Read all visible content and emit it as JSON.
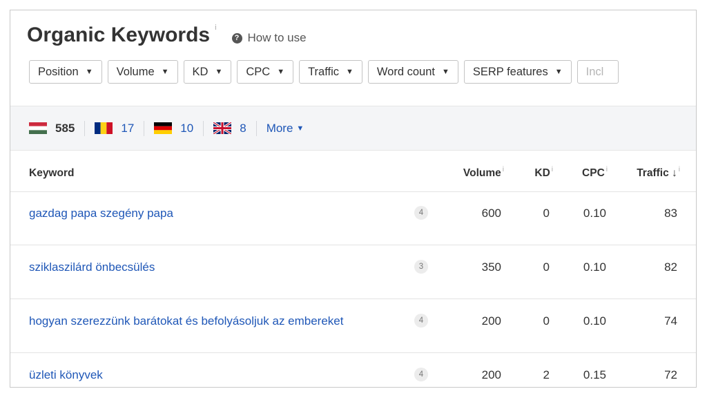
{
  "header": {
    "title": "Organic Keywords",
    "title_info": "i",
    "help_icon": "?",
    "how_to_use": "How to use"
  },
  "filters": {
    "items": [
      {
        "label": "Position",
        "caret": "▼"
      },
      {
        "label": "Volume",
        "caret": "▼"
      },
      {
        "label": "KD",
        "caret": "▼"
      },
      {
        "label": "CPC",
        "caret": "▼"
      },
      {
        "label": "Traffic",
        "caret": "▼"
      },
      {
        "label": "Word count",
        "caret": "▼"
      },
      {
        "label": "SERP features",
        "caret": "▼"
      }
    ],
    "include_placeholder": "Incl"
  },
  "countries": {
    "items": [
      {
        "flag": "hungary-flag",
        "count": "585"
      },
      {
        "flag": "romania-flag",
        "count": "17"
      },
      {
        "flag": "germany-flag",
        "count": "10"
      },
      {
        "flag": "uk-flag",
        "count": "8"
      }
    ],
    "more_label": "More",
    "more_caret": "▼"
  },
  "table": {
    "columns": {
      "keyword": "Keyword",
      "volume": "Volume",
      "kd": "KD",
      "cpc": "CPC",
      "traffic": "Traffic",
      "traffic_sort": "↓",
      "info": "i"
    },
    "rows": [
      {
        "keyword": "gazdag papa szegény papa",
        "position": "4",
        "volume": "600",
        "kd": "0",
        "cpc": "0.10",
        "traffic": "83"
      },
      {
        "keyword": "sziklaszilárd önbecsülés",
        "position": "3",
        "volume": "350",
        "kd": "0",
        "cpc": "0.10",
        "traffic": "82"
      },
      {
        "keyword": "hogyan szerezzünk barátokat és befolyásoljuk az embereket",
        "position": "4",
        "volume": "200",
        "kd": "0",
        "cpc": "0.10",
        "traffic": "74"
      },
      {
        "keyword": "üzleti könyvek",
        "position": "4",
        "volume": "200",
        "kd": "2",
        "cpc": "0.15",
        "traffic": "72"
      }
    ]
  },
  "colors": {
    "link": "#1f57b7",
    "country_bar_bg": "#f4f5f7",
    "border": "#c8c8c8"
  }
}
